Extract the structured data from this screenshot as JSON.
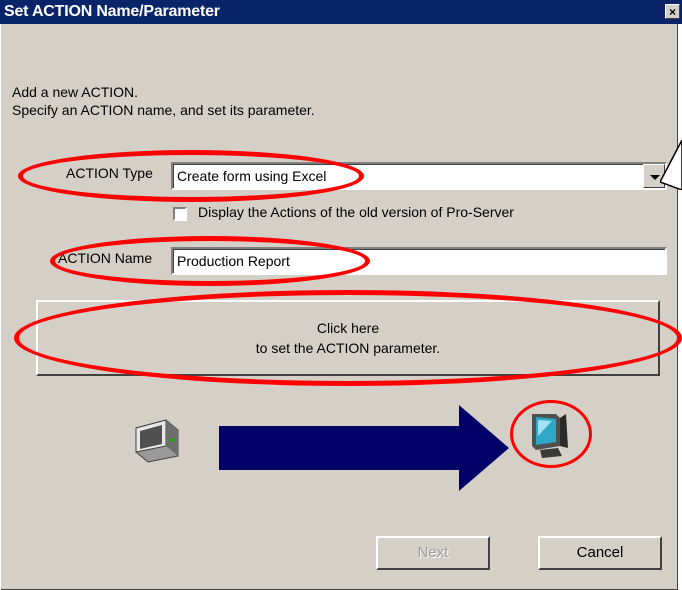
{
  "window": {
    "title": "Set ACTION Name/Parameter",
    "close_glyph": "×"
  },
  "intro": {
    "line1": "Add a new ACTION.",
    "line2": "Specify an ACTION name, and set its parameter."
  },
  "action_type": {
    "label": "ACTION Type",
    "value": "Create form using Excel"
  },
  "old_version_checkbox": {
    "label": "Display the Actions of the old version of Pro-Server",
    "checked": false
  },
  "action_name": {
    "label": "ACTION Name",
    "value": "Production Report"
  },
  "parameter_button": {
    "line1": "Click here",
    "line2": "to set the ACTION parameter."
  },
  "buttons": {
    "next": "Next",
    "cancel": "Cancel"
  },
  "icons": {
    "source": "display-device-icon",
    "arrow": "arrow-right-icon",
    "target": "pc-monitor-icon"
  },
  "colors": {
    "title_bar": "#0a246a",
    "annotation": "#ff0000",
    "arrow": "#000066"
  }
}
